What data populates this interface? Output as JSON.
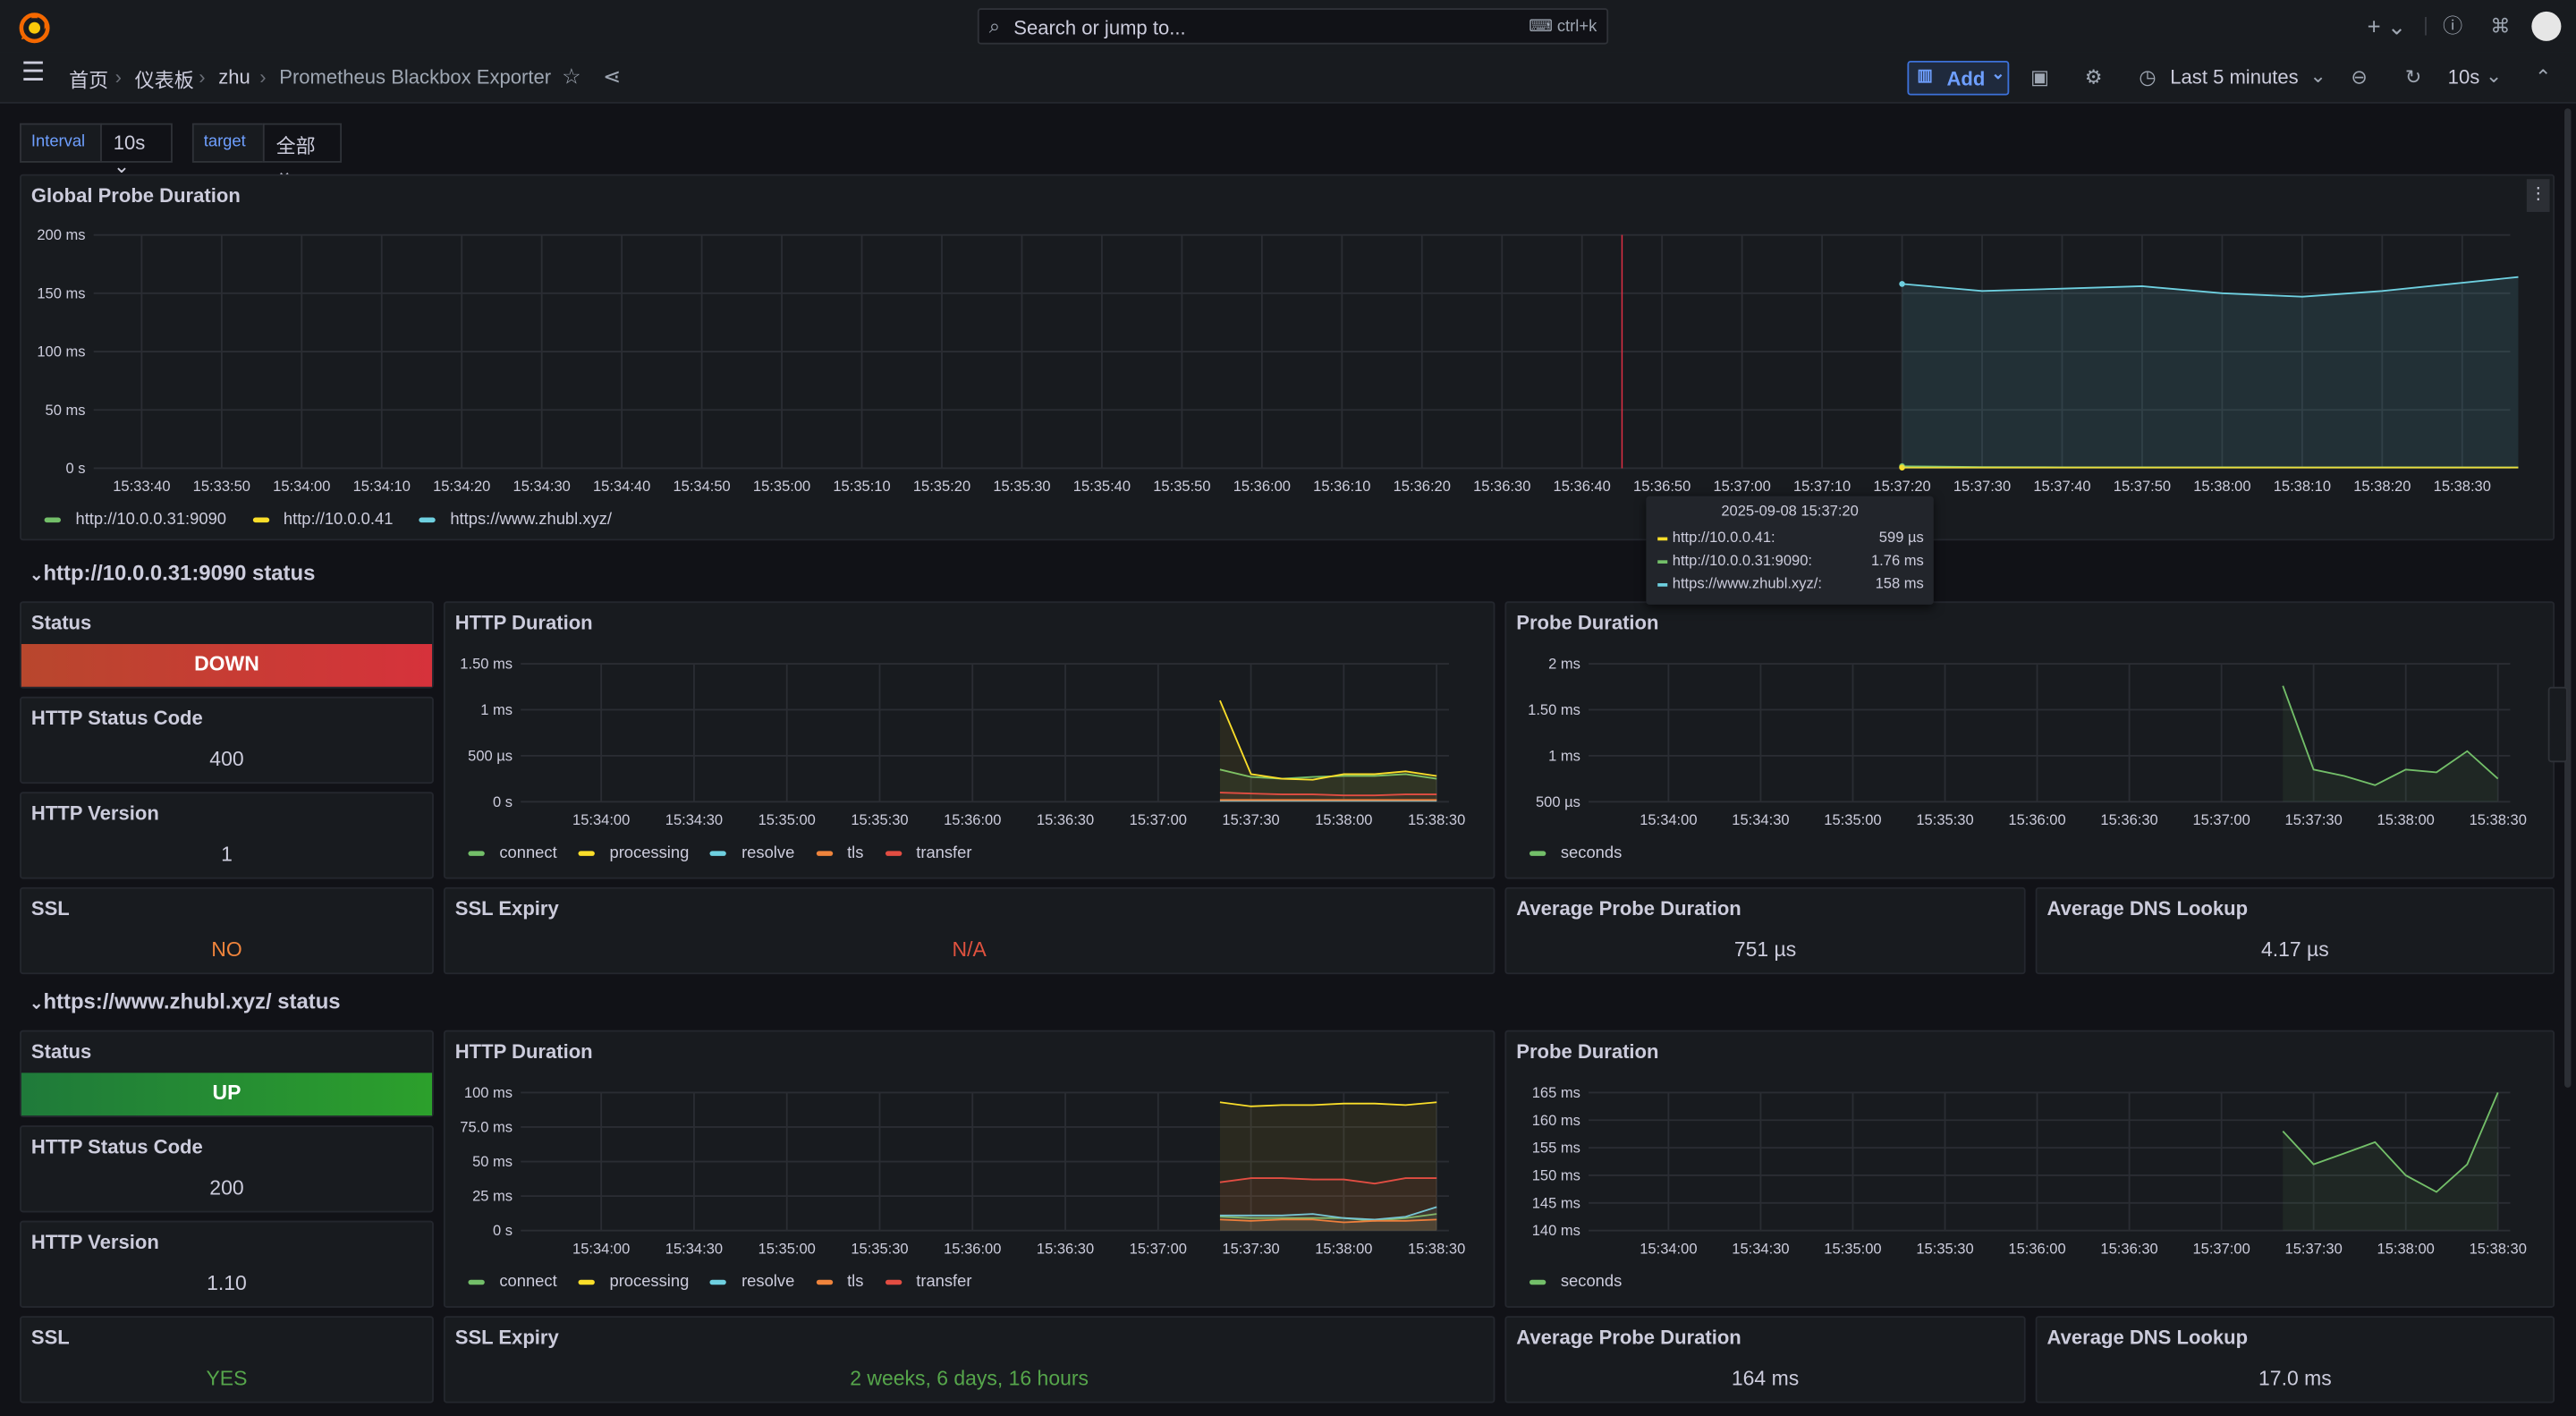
{
  "topbar": {
    "search_placeholder": "Search or jump to...",
    "search_shortcut": "ctrl+k",
    "new_label": "+"
  },
  "breadcrumb": [
    "首页",
    "仪表板",
    "zhu",
    "Prometheus Blackbox Exporter"
  ],
  "toolbar": {
    "add_label": "Add",
    "time_range": "Last 5 minutes",
    "refresh_interval": "10s"
  },
  "variables": [
    {
      "label": "Interval",
      "value": "10s"
    },
    {
      "label": "target",
      "value": "全部"
    }
  ],
  "global_panel": {
    "title": "Global Probe Duration",
    "y_ticks": [
      "200 ms",
      "150 ms",
      "100 ms",
      "50 ms",
      "0 s"
    ],
    "x_ticks": [
      "15:33:40",
      "15:33:50",
      "15:34:00",
      "15:34:10",
      "15:34:20",
      "15:34:30",
      "15:34:40",
      "15:34:50",
      "15:35:00",
      "15:35:10",
      "15:35:20",
      "15:35:30",
      "15:35:40",
      "15:35:50",
      "15:36:00",
      "15:36:10",
      "15:36:20",
      "15:36:30",
      "15:36:40",
      "15:36:50",
      "15:37:00",
      "15:37:10",
      "15:37:20",
      "15:37:30",
      "15:37:40",
      "15:37:50",
      "15:38:00",
      "15:38:10",
      "15:38:20",
      "15:38:30"
    ],
    "legend": [
      "http://10.0.0.31:9090",
      "http://10.0.0.41",
      "https://www.zhubl.xyz/"
    ],
    "colors": {
      "s1": "#73bf69",
      "s2": "#fade2a",
      "s3": "#6ed0e0"
    }
  },
  "tooltip": {
    "time": "2025-09-08 15:37:20",
    "rows": [
      {
        "name": "http://10.0.0.41:",
        "value": "599 µs",
        "color": "#fade2a"
      },
      {
        "name": "http://10.0.0.31:9090:",
        "value": "1.76 ms",
        "color": "#73bf69"
      },
      {
        "name": "https://www.zhubl.xyz/:",
        "value": "158 ms",
        "color": "#6ed0e0"
      }
    ]
  },
  "rows": [
    {
      "title": "http://10.0.0.31:9090 status",
      "status_title": "Status",
      "status_value": "DOWN",
      "code_title": "HTTP Status Code",
      "code_value": "400",
      "version_title": "HTTP Version",
      "version_value": "1",
      "ssl_title": "SSL",
      "ssl_value": "NO",
      "expiry_title": "SSL Expiry",
      "expiry_value": "N/A",
      "avg_probe_title": "Average Probe Duration",
      "avg_probe_value": "751 µs",
      "avg_dns_title": "Average DNS Lookup",
      "avg_dns_value": "4.17 µs",
      "http_title": "HTTP Duration",
      "http_y_ticks": [
        "1.50 ms",
        "1 ms",
        "500 µs",
        "0 s"
      ],
      "probe_title": "Probe Duration",
      "probe_y_ticks": [
        "2 ms",
        "1.50 ms",
        "1 ms",
        "500 µs"
      ]
    },
    {
      "title": "https://www.zhubl.xyz/ status",
      "status_title": "Status",
      "status_value": "UP",
      "code_title": "HTTP Status Code",
      "code_value": "200",
      "version_title": "HTTP Version",
      "version_value": "1.10",
      "ssl_title": "SSL",
      "ssl_value": "YES",
      "expiry_title": "SSL Expiry",
      "expiry_value": "2 weeks, 6 days, 16 hours",
      "avg_probe_title": "Average Probe Duration",
      "avg_probe_value": "164 ms",
      "avg_dns_title": "Average DNS Lookup",
      "avg_dns_value": "17.0 ms",
      "http_title": "HTTP Duration",
      "http_y_ticks": [
        "100 ms",
        "75.0 ms",
        "50 ms",
        "25 ms",
        "0 s"
      ],
      "probe_title": "Probe Duration",
      "probe_y_ticks": [
        "165 ms",
        "160 ms",
        "155 ms",
        "150 ms",
        "145 ms",
        "140 ms"
      ]
    }
  ],
  "small_x_ticks": [
    "15:34:00",
    "15:34:30",
    "15:35:00",
    "15:35:30",
    "15:36:00",
    "15:36:30",
    "15:37:00",
    "15:37:30",
    "15:38:00",
    "15:38:30"
  ],
  "http_legend": [
    {
      "name": "connect",
      "color": "#73bf69"
    },
    {
      "name": "processing",
      "color": "#fade2a"
    },
    {
      "name": "resolve",
      "color": "#6ed0e0"
    },
    {
      "name": "tls",
      "color": "#ef843c"
    },
    {
      "name": "transfer",
      "color": "#e24d42"
    }
  ],
  "probe_legend": [
    {
      "name": "seconds",
      "color": "#73bf69"
    }
  ],
  "chart_data": [
    {
      "type": "line",
      "title": "Global Probe Duration",
      "x": [
        "15:37:20",
        "15:37:30",
        "15:37:40",
        "15:37:50",
        "15:38:00",
        "15:38:10",
        "15:38:20",
        "15:38:30"
      ],
      "ylim": [
        0,
        200
      ],
      "ylabel_unit": "ms",
      "series": [
        {
          "name": "http://10.0.0.31:9090",
          "values": [
            1.76,
            1.0,
            0.9,
            0.8,
            0.8,
            0.75,
            0.8,
            0.75
          ]
        },
        {
          "name": "http://10.0.0.41",
          "values": [
            0.6,
            0.6,
            0.6,
            0.6,
            0.6,
            0.6,
            0.6,
            0.6
          ]
        },
        {
          "name": "https://www.zhubl.xyz/",
          "values": [
            158,
            152,
            154,
            156,
            150,
            147,
            152,
            164
          ]
        }
      ]
    },
    {
      "type": "line",
      "title": "HTTP Duration",
      "x": [
        "15:37:20",
        "15:37:30",
        "15:37:40",
        "15:37:50",
        "15:38:00",
        "15:38:10",
        "15:38:20",
        "15:38:30"
      ],
      "ylim": [
        0,
        1.5
      ],
      "ylabel_unit": "ms",
      "series": [
        {
          "name": "connect",
          "values": [
            0.35,
            0.27,
            0.25,
            0.27,
            0.28,
            0.28,
            0.3,
            0.25
          ]
        },
        {
          "name": "processing",
          "values": [
            1.1,
            0.3,
            0.25,
            0.24,
            0.3,
            0.3,
            0.33,
            0.28
          ]
        },
        {
          "name": "resolve",
          "values": [
            0.01,
            0.01,
            0.01,
            0.01,
            0.01,
            0.01,
            0.01,
            0.01
          ]
        },
        {
          "name": "tls",
          "values": [
            0.02,
            0.02,
            0.02,
            0.02,
            0.02,
            0.02,
            0.02,
            0.02
          ]
        },
        {
          "name": "transfer",
          "values": [
            0.1,
            0.09,
            0.08,
            0.08,
            0.07,
            0.07,
            0.08,
            0.08
          ]
        }
      ]
    },
    {
      "type": "line",
      "title": "Probe Duration",
      "x": [
        "15:37:20",
        "15:37:30",
        "15:37:40",
        "15:37:50",
        "15:38:00",
        "15:38:10",
        "15:38:20",
        "15:38:30"
      ],
      "ylim": [
        0.5,
        2
      ],
      "ylabel_unit": "ms",
      "series": [
        {
          "name": "seconds",
          "values": [
            1.76,
            0.85,
            0.78,
            0.68,
            0.85,
            0.82,
            1.05,
            0.75
          ]
        }
      ]
    },
    {
      "type": "line",
      "title": "HTTP Duration",
      "x": [
        "15:37:20",
        "15:37:30",
        "15:37:40",
        "15:37:50",
        "15:38:00",
        "15:38:10",
        "15:38:20",
        "15:38:30"
      ],
      "ylim": [
        0,
        100
      ],
      "ylabel_unit": "ms",
      "series": [
        {
          "name": "connect",
          "values": [
            10,
            9,
            9,
            9,
            9,
            7,
            9,
            12
          ]
        },
        {
          "name": "processing",
          "values": [
            93,
            90,
            91,
            91,
            92,
            92,
            91,
            93
          ]
        },
        {
          "name": "resolve",
          "values": [
            11,
            11,
            11,
            12,
            9,
            8,
            10,
            17
          ]
        },
        {
          "name": "tls",
          "values": [
            8,
            7,
            8,
            8,
            6,
            7,
            7,
            8
          ]
        },
        {
          "name": "transfer",
          "values": [
            35,
            38,
            38,
            37,
            37,
            34,
            38,
            38
          ]
        }
      ]
    },
    {
      "type": "line",
      "title": "Probe Duration",
      "x": [
        "15:37:20",
        "15:37:30",
        "15:37:40",
        "15:37:50",
        "15:38:00",
        "15:38:10",
        "15:38:20",
        "15:38:30"
      ],
      "ylim": [
        140,
        165
      ],
      "ylabel_unit": "ms",
      "series": [
        {
          "name": "seconds",
          "values": [
            158,
            152,
            154,
            156,
            150,
            147,
            152,
            165
          ]
        }
      ]
    }
  ]
}
